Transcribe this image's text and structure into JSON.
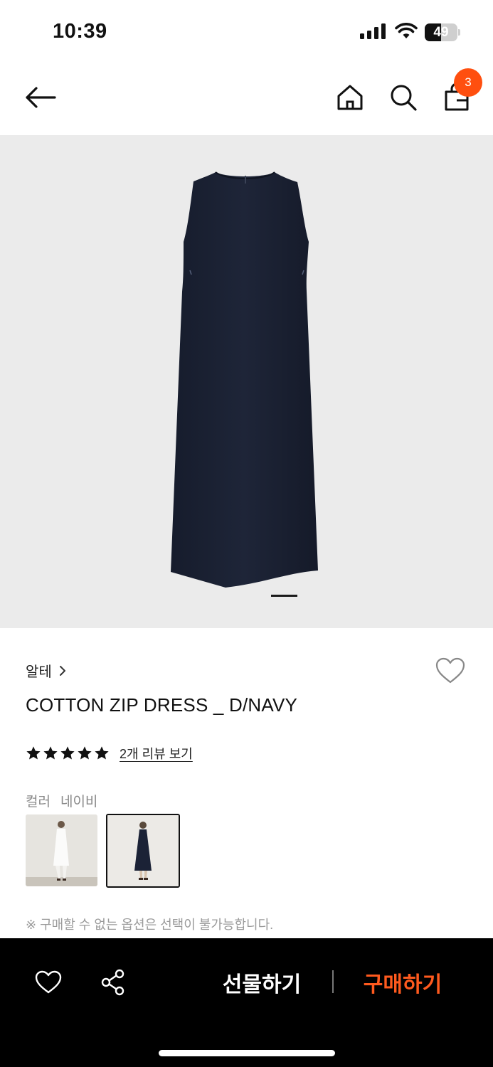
{
  "status_bar": {
    "time": "10:39",
    "battery": "49",
    "battery_level": 0.49,
    "icons": [
      "cellular-signal-icon",
      "wifi-icon",
      "battery-icon"
    ]
  },
  "header": {
    "icons": [
      "back-arrow-icon",
      "home-icon",
      "search-icon",
      "shopping-bag-icon"
    ],
    "cart_count": "3",
    "badge_color": "#ff4f0f"
  },
  "product": {
    "image_icon": "navy-sleeveless-dress-image",
    "carousel_active_index": 1,
    "brand": "알테",
    "name": "COTTON ZIP DRESS _ D/NAVY",
    "rating_stars": 5,
    "review_link": "2개 리뷰 보기",
    "color_label": "컬러",
    "color_value": "네이비",
    "swatches": [
      {
        "name": "white",
        "selected": false
      },
      {
        "name": "navy",
        "selected": true
      }
    ],
    "option_note": "※ 구매할 수 없는 옵션은 선택이 불가능합니다."
  },
  "bottom_bar": {
    "gift_label": "선물하기",
    "buy_label": "구매하기",
    "buy_color": "#ff5a1e",
    "icons": [
      "heart-icon",
      "share-icon"
    ]
  },
  "colors": {
    "accent": "#ff4f0f",
    "dress_navy": "#1b2236",
    "bar_background": "#000000"
  }
}
